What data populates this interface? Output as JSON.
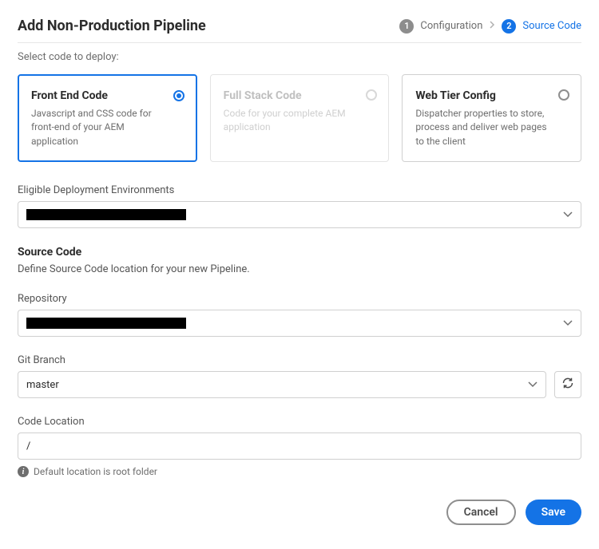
{
  "header": {
    "title": "Add Non-Production Pipeline",
    "steps": [
      {
        "num": "1",
        "label": "Configuration",
        "active": false
      },
      {
        "num": "2",
        "label": "Source Code",
        "active": true
      }
    ]
  },
  "select_label": "Select code to deploy:",
  "cards": [
    {
      "title": "Front End Code",
      "desc": "Javascript and CSS code for front-end of your AEM application",
      "state": "selected"
    },
    {
      "title": "Full Stack Code",
      "desc": "Code for your complete AEM application",
      "state": "disabled"
    },
    {
      "title": "Web Tier Config",
      "desc": "Dispatcher properties to store, process and deliver web pages to the client",
      "state": "normal"
    }
  ],
  "env": {
    "label": "Eligible Deployment Environments",
    "value": ""
  },
  "source_code": {
    "title": "Source Code",
    "desc": "Define Source Code location for your new Pipeline."
  },
  "repository": {
    "label": "Repository",
    "value": ""
  },
  "git_branch": {
    "label": "Git Branch",
    "value": "master"
  },
  "code_location": {
    "label": "Code Location",
    "value": "/",
    "helper": "Default location is root folder"
  },
  "footer": {
    "cancel": "Cancel",
    "save": "Save"
  }
}
